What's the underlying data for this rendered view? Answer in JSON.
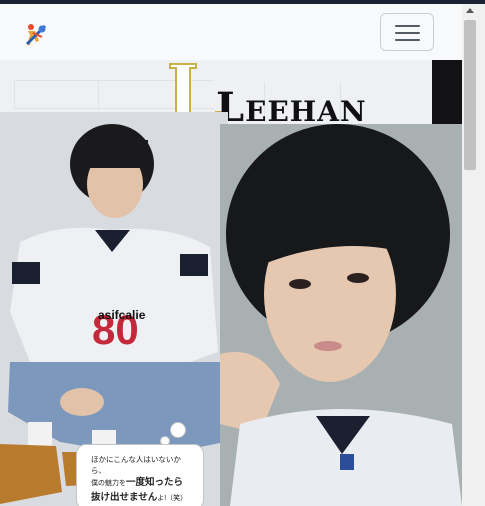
{
  "navbar": {
    "logo_icon": "guitar-figure-logo-icon",
    "menu_icon": "hamburger-menu-icon"
  },
  "magazine": {
    "title_initial": "L",
    "title_first": "L",
    "title_rest": "EEHAN",
    "jersey_brand": "asifcalie",
    "jersey_number": "80",
    "caption_line1": "ほかにこんな人はいないから、",
    "caption_line2_pre": "僕の魅力を",
    "caption_line2_bold": "一度知ったら",
    "caption_line3_bold": "抜け出せません",
    "caption_line3_tail": "よ!（笑）"
  },
  "colors": {
    "navbar_bg": "#f8f9fa",
    "outer_bg": "#1b2233",
    "title_gold": "#c9b04a"
  }
}
